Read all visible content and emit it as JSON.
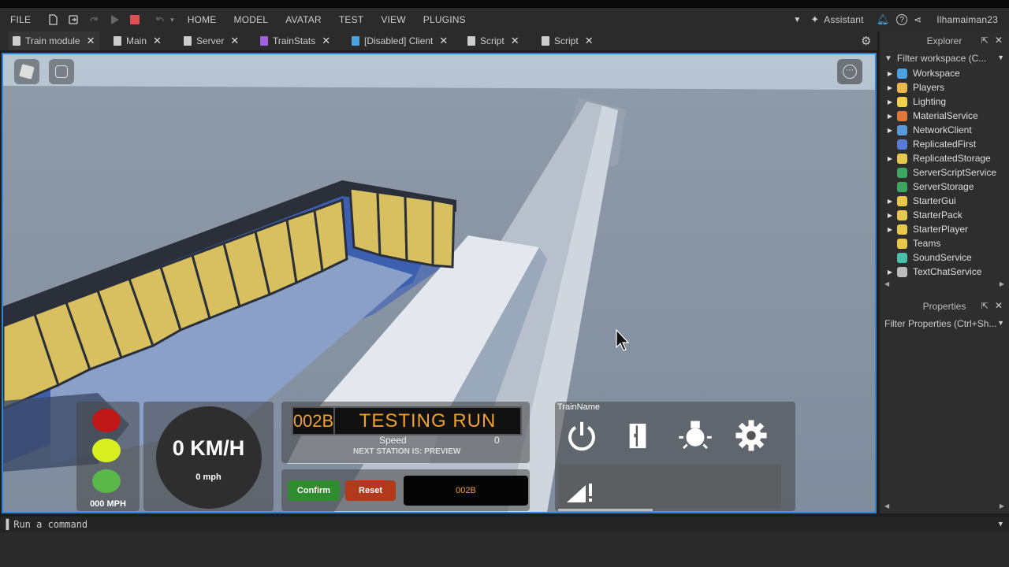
{
  "menubar": {
    "file": "FILE",
    "items": [
      "HOME",
      "MODEL",
      "AVATAR",
      "TEST",
      "VIEW",
      "PLUGINS"
    ],
    "assistant": "Assistant",
    "username": "Ilhamaiman23"
  },
  "tabs": [
    {
      "label": "Train module"
    },
    {
      "label": "Main"
    },
    {
      "label": "Server"
    },
    {
      "label": "TrainStats"
    },
    {
      "label": "[Disabled] Client"
    },
    {
      "label": "Script"
    },
    {
      "label": "Script"
    }
  ],
  "explorer": {
    "title": "Explorer",
    "filter_placeholder": "Filter workspace (C...",
    "items": [
      {
        "label": "Workspace",
        "color": "#4aa3e0",
        "arrow": true
      },
      {
        "label": "Players",
        "color": "#e8b84a",
        "arrow": true
      },
      {
        "label": "Lighting",
        "color": "#f2d14a",
        "arrow": true
      },
      {
        "label": "MaterialService",
        "color": "#e0783a",
        "arrow": true
      },
      {
        "label": "NetworkClient",
        "color": "#5a9ad8",
        "arrow": true
      },
      {
        "label": "ReplicatedFirst",
        "color": "#5a7ad8",
        "arrow": false
      },
      {
        "label": "ReplicatedStorage",
        "color": "#e8c84a",
        "arrow": true
      },
      {
        "label": "ServerScriptService",
        "color": "#3aa860",
        "arrow": false
      },
      {
        "label": "ServerStorage",
        "color": "#3aa860",
        "arrow": false
      },
      {
        "label": "StarterGui",
        "color": "#e8c84a",
        "arrow": true
      },
      {
        "label": "StarterPack",
        "color": "#e8c84a",
        "arrow": true
      },
      {
        "label": "StarterPlayer",
        "color": "#e8c84a",
        "arrow": true
      },
      {
        "label": "Teams",
        "color": "#e8c84a",
        "arrow": false
      },
      {
        "label": "SoundService",
        "color": "#4ac0a8",
        "arrow": false
      },
      {
        "label": "TextChatService",
        "color": "#bbbbbb",
        "arrow": true
      }
    ]
  },
  "properties": {
    "title": "Properties",
    "filter_placeholder": "Filter Properties (Ctrl+Sh..."
  },
  "command": {
    "placeholder": "Run a command"
  },
  "hud": {
    "speed_kmh": "0 KM/H",
    "speed_mph": "0 mph",
    "mph_small": "000 MPH",
    "train_id": "002B",
    "destination": "TESTING RUN",
    "speed_label": "Speed",
    "speed_value": "0",
    "next_station": "NEXT STATION IS: PREVIEW",
    "confirm": "Confirm",
    "reset": "Reset",
    "id_field": "002B",
    "train_name": "TrainName"
  },
  "colors": {
    "accent": "#2a86d8",
    "confirm": "#2e8b2e",
    "reset": "#b23a1a",
    "display_text": "#f0a030"
  }
}
